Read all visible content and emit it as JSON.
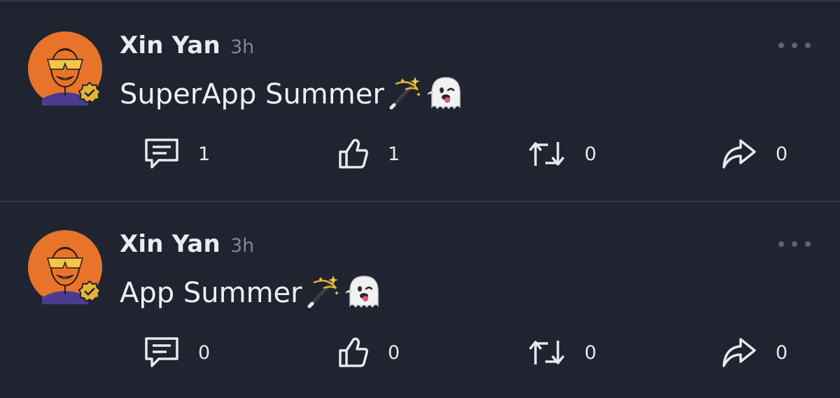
{
  "posts": [
    {
      "author": "Xin Yan",
      "time": "3h",
      "text": "SuperApp Summer",
      "emojis": [
        "magic-wand-emoji",
        "ghost-emoji"
      ],
      "actions": {
        "comments": "1",
        "likes": "1",
        "reposts": "0",
        "shares": "0"
      }
    },
    {
      "author": "Xin Yan",
      "time": "3h",
      "text": "App Summer",
      "emojis": [
        "magic-wand-emoji",
        "ghost-emoji"
      ],
      "actions": {
        "comments": "0",
        "likes": "0",
        "reposts": "0",
        "shares": "0"
      }
    }
  ],
  "icons": {
    "avatar": "avatar-orange",
    "verified": "verified-badge-icon",
    "more": "more-options-icon",
    "comment": "comment-icon",
    "like": "thumbs-up-icon",
    "repost": "repost-icon",
    "share": "share-icon"
  },
  "colors": {
    "background": "#1f2430",
    "divider": "#323a48",
    "text_primary": "#e9ecf1",
    "text_secondary": "#7e8796",
    "avatar_orange": "#e8732a",
    "verified_badge": "#e6b33a"
  }
}
